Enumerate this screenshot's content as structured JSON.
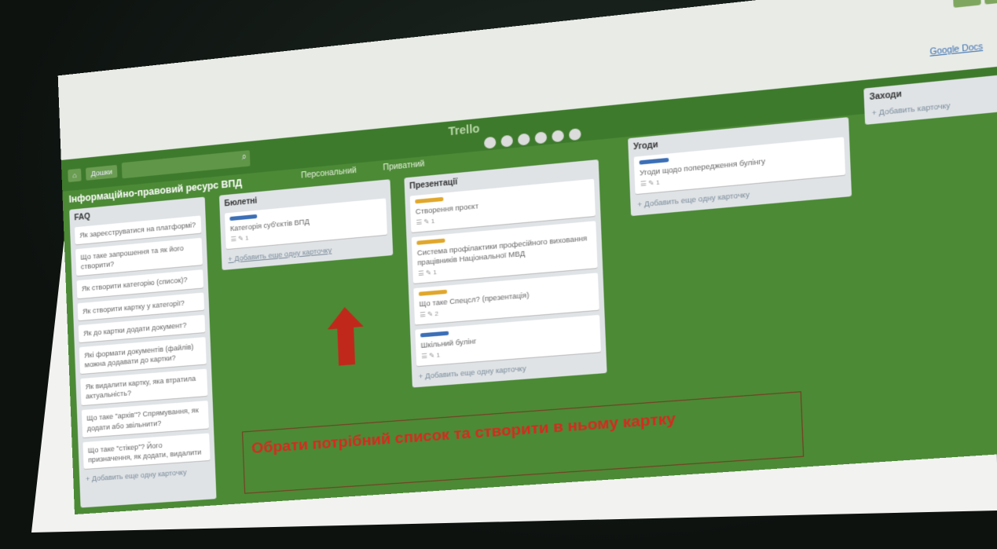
{
  "app": {
    "logo": "Trello",
    "board_title": "Інформаційно-правовий ресурс ВПД",
    "visibility": "Персональний",
    "group": "Приватний",
    "menu_link": "Google Docs"
  },
  "header": {
    "boards_button": "Дошки",
    "search_placeholder": "",
    "top_buttons": [
      "+",
      "ⓘ",
      "🔔"
    ]
  },
  "lists": [
    {
      "title": "FAQ",
      "cards": [
        "Як зареєструватися на платформі?",
        "Що таке запрошення та як його створити?",
        "Як створити категорію (список)?",
        "Як створити картку у категорії?",
        "Як до картки додати документ?",
        "Які формати документів (файлів) можна додавати до картки?",
        "Як видалити картку, яка втратила актуальність?",
        "Що таке \"архів\"? Спрямування, як додати або звільнити?",
        "Що таке \"стікер\"? Його призначення, як додати, видалити"
      ],
      "add_card": "+ Добавить еще одну карточку"
    },
    {
      "title": "Бюлетні",
      "cards": [
        {
          "text": "Категорія суб'єктів ВПД",
          "label": "#3b6fb6",
          "badges": "☰  ✎ 1"
        }
      ],
      "add_card": "+ Добавить еще одну карточку"
    },
    {
      "title": "Презентації",
      "cards": [
        {
          "text": "Створення проєкт",
          "label": "#e0a72c",
          "badges": "☰  ✎ 1"
        },
        {
          "text": "Система профілактики професійного виховання працівників Національної МВД",
          "label": "#e0a72c",
          "badges": "☰  ✎ 1"
        },
        {
          "text": "Що таке Спецсл? (презентація)",
          "label": "#e0a72c",
          "badges": "☰  ✎ 2"
        },
        {
          "text": "Шкільний булінг",
          "label": "#3b6fb6",
          "badges": "☰  ✎ 1"
        }
      ],
      "add_card": "+ Добавить еще одну карточку"
    },
    {
      "title": "Угоди",
      "cards": [
        {
          "text": "Угоди щодо попередження булінгу",
          "label": "#3b6fb6",
          "badges": "☰  ✎ 1"
        }
      ],
      "add_card": "+ Добавить еще одну карточку"
    },
    {
      "title": "Заходи",
      "cards": [],
      "add_card": "+ Добавить карточку"
    }
  ],
  "callout": {
    "text": "Обрати потрібний список та створити в ньому картку"
  },
  "colors": {
    "board_green": "#4c8a36",
    "header_green": "#3e7a2c",
    "arrow_red": "#c0281c",
    "callout_red": "#d8291e"
  }
}
